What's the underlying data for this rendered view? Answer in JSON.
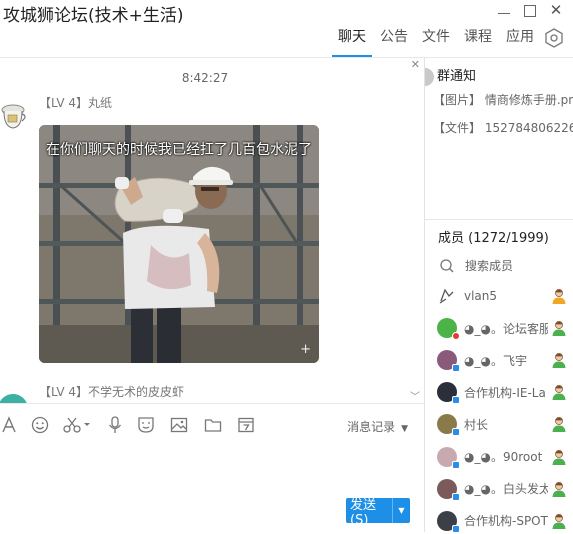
{
  "window": {
    "title": "攻城狮论坛(技术+生活)"
  },
  "tabs": [
    {
      "label": "聊天",
      "active": true
    },
    {
      "label": "公告",
      "active": false
    },
    {
      "label": "文件",
      "active": false
    },
    {
      "label": "课程",
      "active": false
    },
    {
      "label": "应用",
      "active": false
    }
  ],
  "chat": {
    "timestamp": "8:42:27",
    "messages": [
      {
        "level": "【LV 4】",
        "sender": "丸纸",
        "image_caption": "在你们聊天的时候我已经扛了几百包水泥了"
      },
      {
        "level": "【LV 4】",
        "sender": "不学无术的皮皮虾"
      }
    ]
  },
  "toolbar": {
    "history_label": "消息记录",
    "icons": [
      "font-icon",
      "emoji-icon",
      "scissors-icon",
      "microphone-icon",
      "sticker-icon",
      "image-icon",
      "folder-icon",
      "calendar-icon"
    ]
  },
  "send": {
    "label": "发送(S)"
  },
  "notice": {
    "title": "群通知",
    "items": [
      "【图片】 情商修炼手册.png",
      "【文件】 152784806226..."
    ]
  },
  "members": {
    "title": "成员 (1272/1999)",
    "search_placeholder": "搜索成员",
    "list": [
      {
        "name": "vlan5",
        "avatar_color": "#ffffff",
        "badge": "none",
        "role": "owner"
      },
      {
        "name": "◕_◕。论坛客服",
        "avatar_color": "#4bb348",
        "badge": "red",
        "role": "admin"
      },
      {
        "name": "◕_◕。飞宇",
        "avatar_color": "#8a5a7a",
        "badge": "blue",
        "role": "admin"
      },
      {
        "name": "合作机构-IE-La",
        "avatar_color": "#2a2f3a",
        "badge": "blue",
        "role": "admin"
      },
      {
        "name": "村长",
        "avatar_color": "#8a7a4a",
        "badge": "blue",
        "role": "admin"
      },
      {
        "name": "◕_◕。90root",
        "avatar_color": "#c9a9b0",
        "badge": "blue",
        "role": "admin"
      },
      {
        "name": "◕_◕。白头发太",
        "avatar_color": "#7a5a5a",
        "badge": "blue",
        "role": "admin"
      },
      {
        "name": "合作机构-SPOT",
        "avatar_color": "#3a3f48",
        "badge": "blue",
        "role": "admin"
      }
    ]
  },
  "colors": {
    "accent": "#1e8fe6",
    "admin_icon": "#4caf50",
    "owner_icon": "#f2a623"
  }
}
